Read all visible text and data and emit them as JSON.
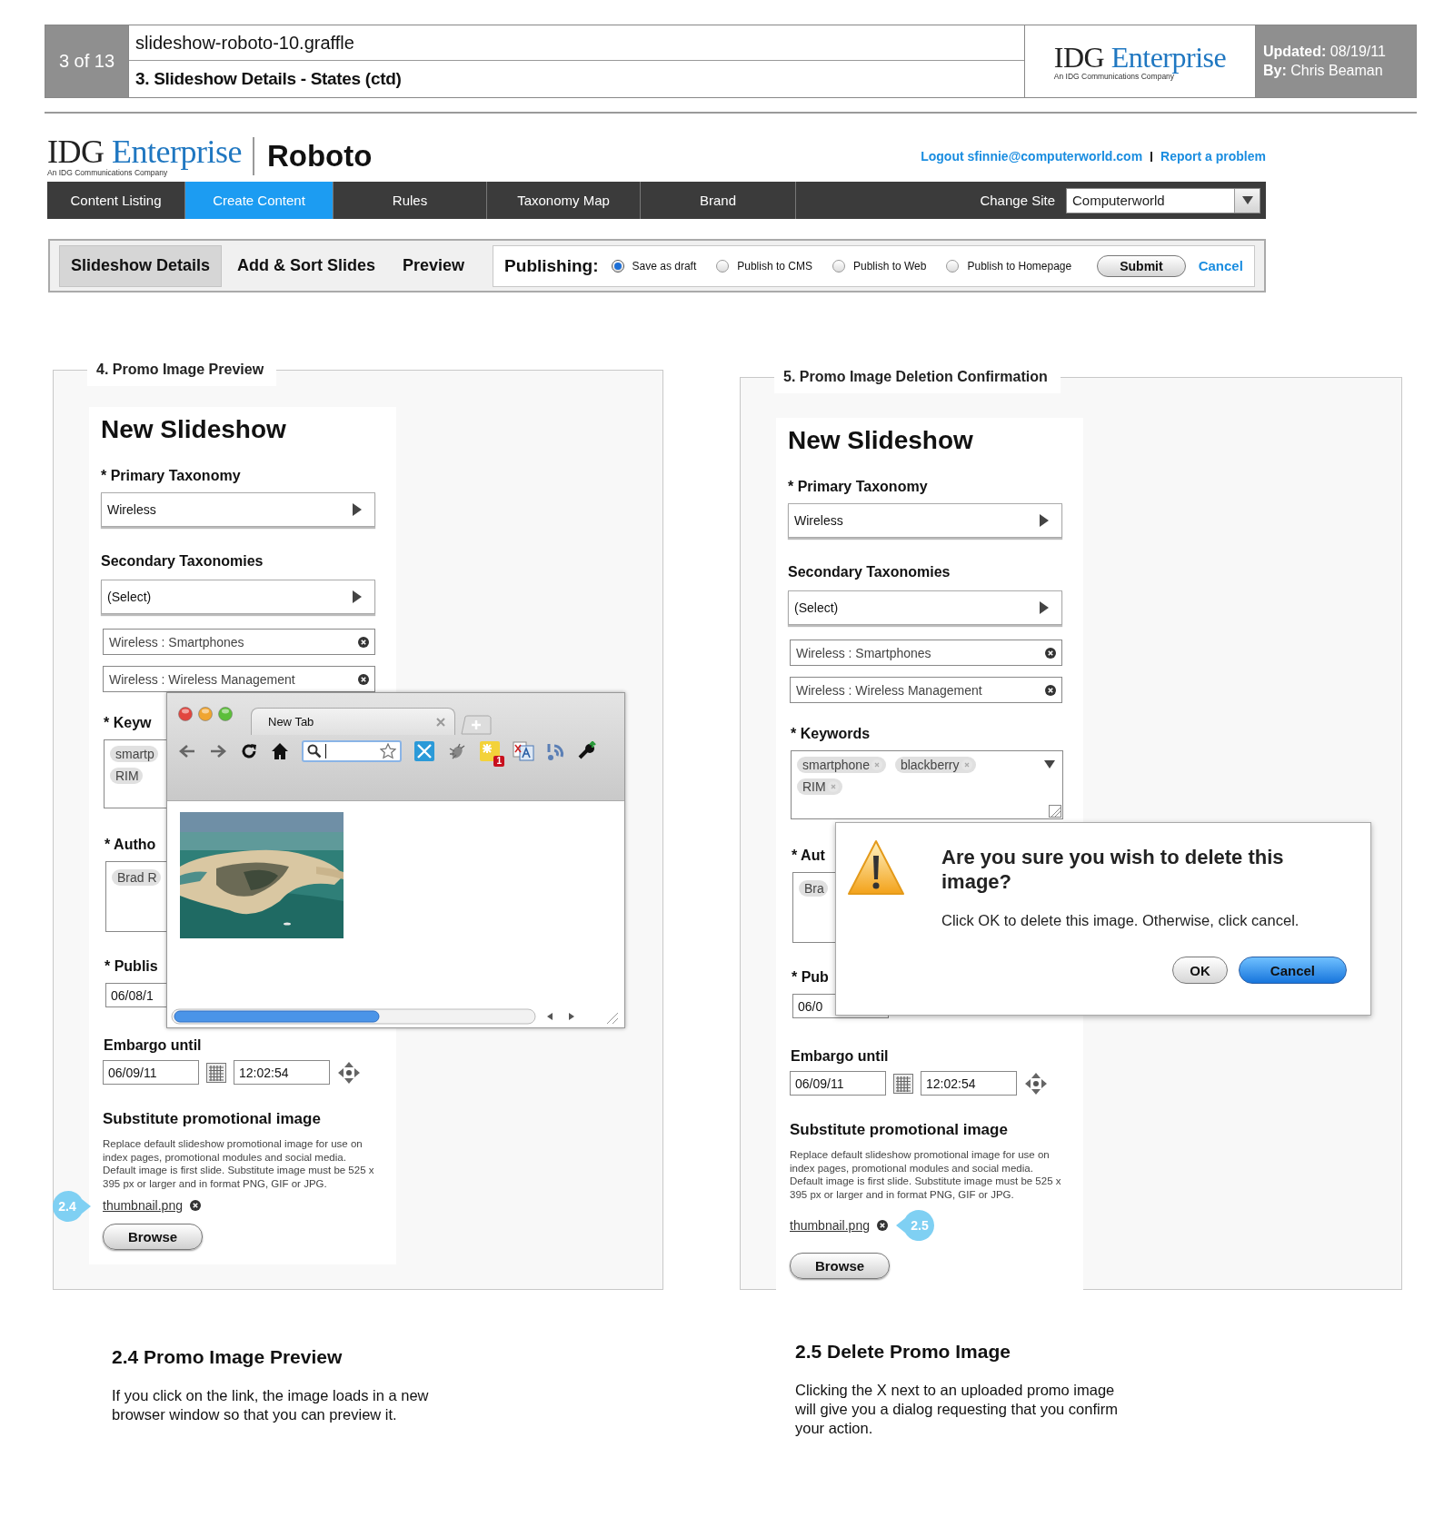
{
  "doc_header": {
    "page": "3 of 13",
    "file": "slideshow-roboto-10.graffle",
    "title": "3. Slideshow Details - States (ctd)",
    "logo": {
      "name": "IDG",
      "accent": "Enterprise",
      "tagline": "An IDG Communications Company"
    },
    "updated": "**Updated:** 08/19/11",
    "by": "**By:** Chris Beaman"
  },
  "app_header": {
    "logo": {
      "name": "IDG",
      "accent": "Enterprise",
      "tagline": "An IDG Communications Company"
    },
    "app_name": "Roboto",
    "links": [
      "Logout sfinnie@computerworld.com",
      "Report a problem"
    ]
  },
  "nav": {
    "items": [
      {
        "label": "Content Listing",
        "selected": false
      },
      {
        "label": "Create Content",
        "selected": true
      },
      {
        "label": "Rules",
        "selected": false
      },
      {
        "label": "Taxonomy Map",
        "selected": false
      },
      {
        "label": "Brand",
        "selected": false
      }
    ],
    "change_site": {
      "label": "Change Site",
      "value": "Computerworld"
    }
  },
  "subnav": {
    "tabs": [
      {
        "label": "Slideshow Details",
        "selected": true
      },
      {
        "label": "Add & Sort Slides",
        "selected": false
      },
      {
        "label": "Preview",
        "selected": false
      }
    ],
    "publishing": {
      "label": "Publishing:",
      "options": [
        {
          "label": "Save as draft",
          "selected": true
        },
        {
          "label": "Publish to CMS",
          "selected": false
        },
        {
          "label": "Publish to Web",
          "selected": false
        },
        {
          "label": "Publish to Homepage",
          "selected": false
        }
      ]
    },
    "submit": "Submit",
    "cancel": "Cancel"
  },
  "panels": [
    {
      "title": "4. Promo Image Preview",
      "form": {
        "title": "New Slideshow",
        "primary": {
          "label": "* Primary Taxonomy",
          "value": "Wireless"
        },
        "secondary": {
          "label": "Secondary Taxonomies",
          "value": "(Select)",
          "items": [
            "Wireless : Smartphones",
            "Wireless : Wireless Management"
          ]
        },
        "keywords": {
          "label": "* Keyw",
          "tag_rows": [
            [
              "smartp"
            ],
            [
              "RIM"
            ]
          ]
        },
        "author": {
          "label": "* Autho",
          "tags": [
            "Brad R"
          ]
        },
        "publish": {
          "label": "* Publis",
          "value": "06/08/1"
        },
        "embargo": {
          "label": "Embargo until",
          "date": "06/09/11",
          "time": "12:02:54"
        },
        "promo": {
          "label": "Substitute promotional image",
          "help": "Replace default slideshow promotional image for use on index pages, promotional modules and social media. Default image is first slide. Substitute image must be 525 x 395 px or larger and in format PNG, GIF or JPG.",
          "file": "thumbnail.png",
          "browse": "Browse",
          "callout": {
            "label": "2.4",
            "kind": "before"
          }
        }
      },
      "overlay": {
        "kind": "browser",
        "tab": "New Tab",
        "badge": "1"
      }
    },
    {
      "title": "5. Promo Image Deletion Confirmation",
      "form": {
        "title": "New Slideshow",
        "primary": {
          "label": "* Primary Taxonomy",
          "value": "Wireless"
        },
        "secondary": {
          "label": "Secondary Taxonomies",
          "value": "(Select)",
          "items": [
            "Wireless : Smartphones",
            "Wireless : Wireless Management"
          ]
        },
        "keywords": {
          "label": "* Keywords",
          "tag_rows": [
            [
              "smartphone",
              "blackberry"
            ],
            [
              "RIM"
            ]
          ]
        },
        "author": {
          "label": "* Aut",
          "tags": [
            "Bra"
          ]
        },
        "publish": {
          "label": "* Pub",
          "value": "06/0"
        },
        "embargo": {
          "label": "Embargo until",
          "date": "06/09/11",
          "time": "12:02:54"
        },
        "promo": {
          "label": "Substitute promotional image",
          "help": "Replace default slideshow promotional image for use on index pages, promotional modules and social media. Default image is first slide. Substitute image must be 525 x 395 px or larger and in format PNG, GIF or JPG.",
          "file": "thumbnail.png",
          "browse": "Browse",
          "callout": {
            "label": "2.5",
            "kind": "after"
          }
        }
      },
      "overlay": {
        "kind": "dialog",
        "title": "Are you sure you wish to delete this image?",
        "message": "Click OK to delete this image. Otherwise, click cancel.",
        "buttons": [
          {
            "label": "OK",
            "kind": "default"
          },
          {
            "label": "Cancel",
            "kind": "primary"
          }
        ]
      }
    }
  ],
  "notes": [
    {
      "title": "2.4 Promo Image Preview",
      "body": "If you click on the link, the image loads in a new browser window so that you can preview it."
    },
    {
      "title": "2.5 Delete Promo Image",
      "body": "Clicking the X next to an uploaded promo image will give you a dialog requesting that you confirm your action."
    }
  ]
}
